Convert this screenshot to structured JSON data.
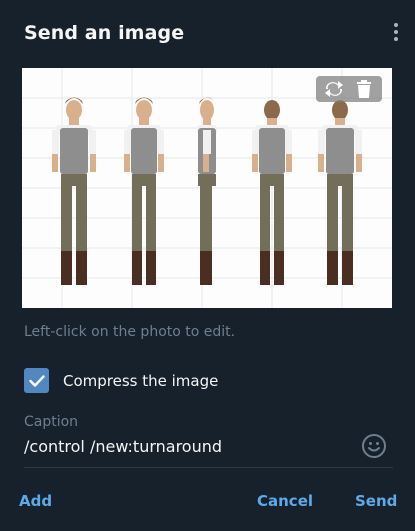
{
  "dialog": {
    "title": "Send an image",
    "menu_icon": "more-vertical-icon"
  },
  "photo": {
    "description_icon": "character-turnaround-image",
    "tools": [
      "replace-icon",
      "delete-icon"
    ]
  },
  "hint": "Left-click on the photo to edit.",
  "compress": {
    "label": "Compress the image",
    "checked": true
  },
  "caption": {
    "label": "Caption",
    "value": "/control /new:turnaround",
    "emoji_icon": "emoji-icon"
  },
  "buttons": {
    "add": "Add",
    "cancel": "Cancel",
    "send": "Send"
  },
  "colors": {
    "background": "#17212b",
    "accent": "#5288c1",
    "link": "#5eaae8",
    "muted": "#6d7f91"
  }
}
